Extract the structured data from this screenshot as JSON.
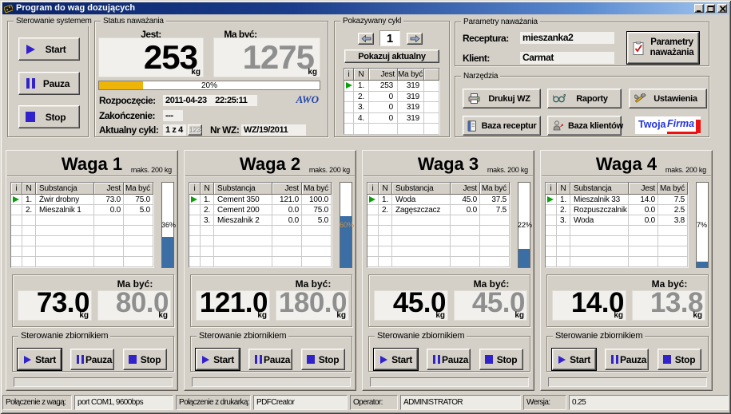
{
  "window": {
    "title": "Program do wag dozujących"
  },
  "titlebar": {
    "minimize": "minimize",
    "maximize": "maximize",
    "close": "close"
  },
  "system_group": {
    "label": "Sterowanie systemem",
    "start": "Start",
    "pauza": "Pauza",
    "stop": "Stop"
  },
  "status_group": {
    "label": "Status naważania",
    "jest_label": "Jest:",
    "jest_value": "253",
    "mabyc_label": "Ma być:",
    "mabyc_value": "1275",
    "unit": "kg",
    "progress_pct": 20,
    "progress_text": "20%",
    "rozpoczecie_label": "Rozpoczęcie:",
    "rozpoczecie_value": "2011-04-23    22:25:11",
    "zakonczenie_label": "Zakończenie:",
    "zakonczenie_value": "---",
    "cykl_label": "Aktualny cykl:",
    "cykl_value": "1 z 4",
    "cykl_btn": "123",
    "nrwz_label": "Nr WZ:",
    "nrwz_value": "WZ/19/2011",
    "logo": "AWO"
  },
  "cycle_group": {
    "label": "Pokazywany cykl",
    "current": "1",
    "show_btn": "Pokazuj aktualny",
    "headers": [
      "i",
      "N",
      "Jest",
      "Ma być",
      ""
    ],
    "rows": [
      {
        "active": true,
        "n": "1.",
        "jest": "253",
        "mabyc": "319"
      },
      {
        "active": false,
        "n": "2.",
        "jest": "0",
        "mabyc": "319"
      },
      {
        "active": false,
        "n": "3.",
        "jest": "0",
        "mabyc": "319"
      },
      {
        "active": false,
        "n": "4.",
        "jest": "0",
        "mabyc": "319"
      },
      {
        "active": false,
        "n": "",
        "jest": "",
        "mabyc": ""
      }
    ]
  },
  "params_group": {
    "label": "Parametry naważania",
    "receptura_label": "Receptura:",
    "receptura_value": "mieszanka2",
    "klient_label": "Klient:",
    "klient_value": "Carmat",
    "button_line1": "Parametry",
    "button_line2": "naważania"
  },
  "tools_group": {
    "label": "Narzędzia",
    "print": "Drukuj WZ",
    "reports": "Raporty",
    "settings": "Ustawienia",
    "recipes": "Baza receptur",
    "clients": "Baza klientów",
    "logo_word1": "Twoja",
    "logo_word2": "Firma"
  },
  "waga_common": {
    "maks": "maks. 200 kg",
    "headers": [
      "i",
      "N",
      "Substancja",
      "Jest",
      "Ma być"
    ],
    "mabyc_label": "Ma być:",
    "unit": "kg",
    "zb_label": "Sterowanie zbiornikiem",
    "start": "Start",
    "pauza": "Pauza",
    "stop": "Stop"
  },
  "wagi": [
    {
      "title": "Waga 1",
      "pct": 36,
      "pct_text": "36%",
      "jest": "73.0",
      "mabyc": "80.0",
      "rows": [
        {
          "active": true,
          "n": "1.",
          "substance": "Żwir drobny",
          "jest": "73.0",
          "mabyc": "75.0"
        },
        {
          "n": "2.",
          "substance": "Mieszalnik 1",
          "jest": "0.0",
          "mabyc": "5.0"
        },
        {},
        {},
        {},
        {},
        {}
      ]
    },
    {
      "title": "Waga 2",
      "pct": 60,
      "pct_text": "60%",
      "jest": "121.0",
      "mabyc": "180.0",
      "rows": [
        {
          "active": true,
          "n": "1.",
          "substance": "Cement 350",
          "jest": "121.0",
          "mabyc": "100.0"
        },
        {
          "n": "2.",
          "substance": "Cement 200",
          "jest": "0.0",
          "mabyc": "75.0"
        },
        {
          "n": "3.",
          "substance": "Mieszalnik 2",
          "jest": "0.0",
          "mabyc": "5.0"
        },
        {},
        {},
        {},
        {}
      ]
    },
    {
      "title": "Waga 3",
      "pct": 22,
      "pct_text": "22%",
      "jest": "45.0",
      "mabyc": "45.0",
      "rows": [
        {
          "active": true,
          "n": "1.",
          "substance": "Woda",
          "jest": "45.0",
          "mabyc": "37.5"
        },
        {
          "n": "2.",
          "substance": "Zagęszczacz",
          "jest": "0.0",
          "mabyc": "7.5"
        },
        {},
        {},
        {},
        {},
        {}
      ]
    },
    {
      "title": "Waga 4",
      "pct": 7,
      "pct_text": "7%",
      "jest": "14.0",
      "mabyc": "13.8",
      "rows": [
        {
          "active": true,
          "n": "1.",
          "substance": "Mieszalnik 33",
          "jest": "14.0",
          "mabyc": "7.5"
        },
        {
          "n": "2.",
          "substance": "Rozpuszczalnik",
          "jest": "0.0",
          "mabyc": "2.5"
        },
        {
          "n": "3.",
          "substance": "Woda",
          "jest": "0.0",
          "mabyc": "3.8"
        },
        {},
        {},
        {},
        {}
      ]
    }
  ],
  "statusbar": [
    {
      "text": "Połączenie z wagą:",
      "kind": "label"
    },
    {
      "text": "port COM1, 9600bps",
      "kind": "value"
    },
    {
      "text": "Połączenie z drukarką:",
      "kind": "label"
    },
    {
      "text": "PDFCreator",
      "kind": "value"
    },
    {
      "text": "Operator:",
      "kind": "label"
    },
    {
      "text": "ADMINISTRATOR",
      "kind": "value"
    },
    {
      "text": "Wersja:",
      "kind": "label"
    },
    {
      "text": "0.25",
      "kind": "value"
    }
  ],
  "colors": {
    "accent_blue": "#3222cc",
    "bar_fill_blue": "#3a6ea5",
    "bar_pct_on_fill": "#c8924f",
    "progress_yellow": "#eeb408",
    "logo_blue": "#2233dd",
    "logo_red": "#ee1111",
    "titlebar_left": "#0a246a",
    "titlebar_right": "#a2c6f0",
    "desktop_gray": "#d4d0c8"
  }
}
